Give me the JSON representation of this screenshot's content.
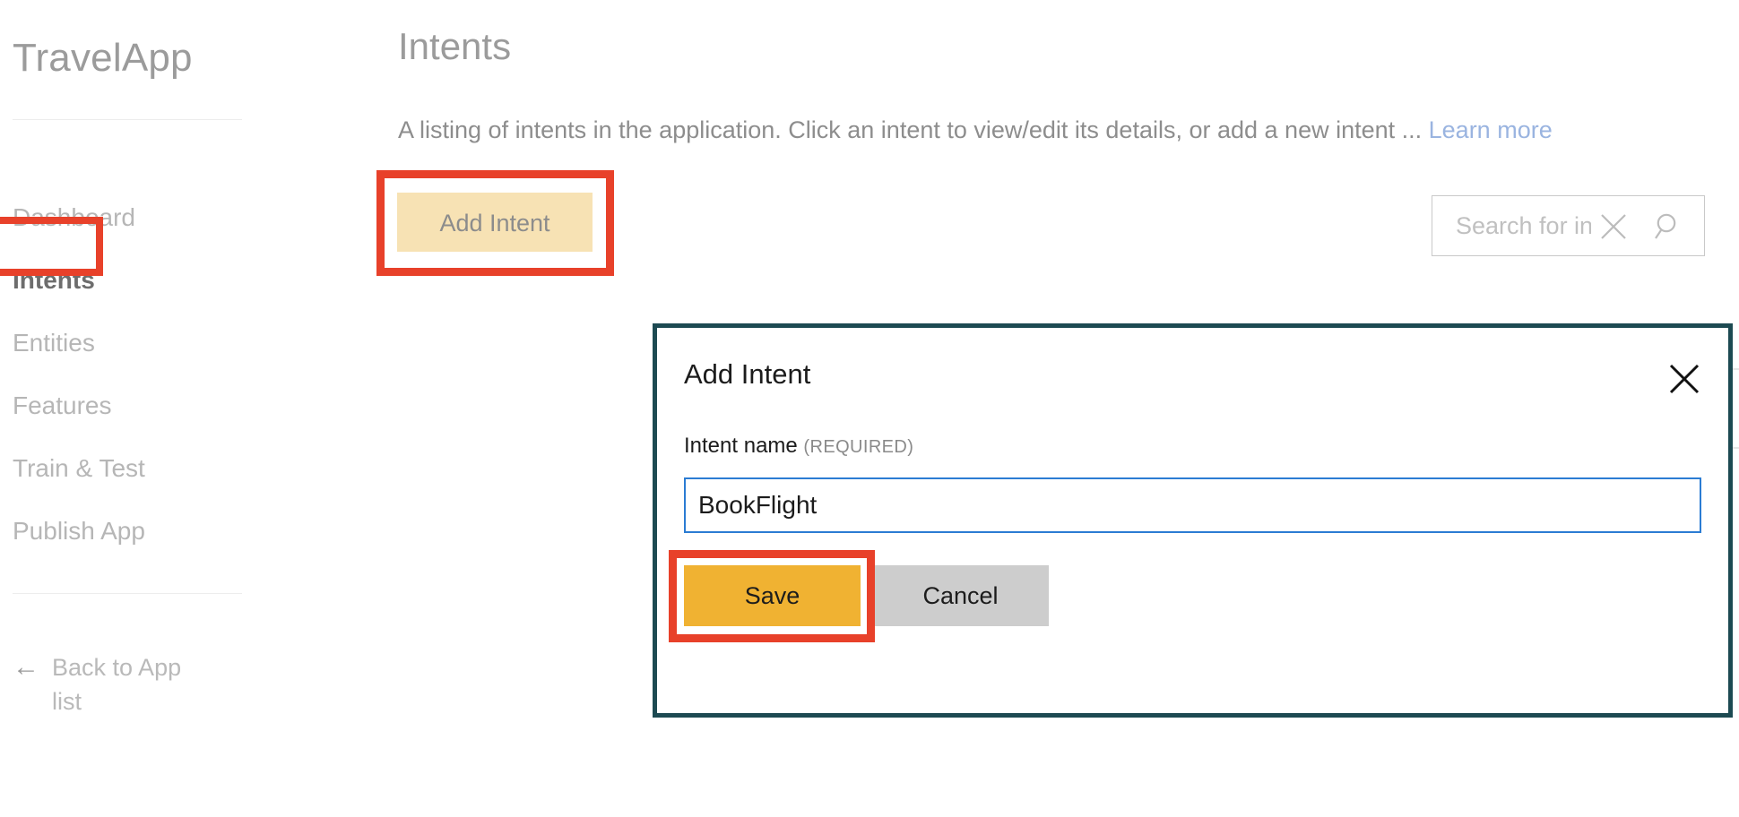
{
  "sidebar": {
    "app_title": "TravelApp",
    "items": [
      {
        "label": "Dashboard",
        "active": false
      },
      {
        "label": "Intents",
        "active": true
      },
      {
        "label": "Entities",
        "active": false
      },
      {
        "label": "Features",
        "active": false
      },
      {
        "label": "Train & Test",
        "active": false
      },
      {
        "label": "Publish App",
        "active": false
      }
    ],
    "back_link": {
      "arrow_icon": "arrow-left-icon",
      "label": "Back to App list"
    }
  },
  "main": {
    "page_title": "Intents",
    "description": "A listing of intents in the application. Click an intent to view/edit its details, or add a new intent ... ",
    "learn_more_label": "Learn more",
    "add_intent_label": "Add Intent",
    "search": {
      "value": "",
      "placeholder": "Search for intents",
      "clear_icon": "close-icon",
      "submit_icon": "search-icon"
    }
  },
  "modal": {
    "title": "Add Intent",
    "close_icon": "close-icon",
    "field_label": "Intent name",
    "field_required_tag": "(REQUIRED)",
    "intent_name_value": "BookFlight",
    "intent_name_placeholder": "",
    "save_label": "Save",
    "cancel_label": "Cancel"
  },
  "annotations": {
    "color": "#e8412a",
    "targets": [
      "sidebar-item-intents",
      "add-intent-button",
      "save-button"
    ]
  },
  "colors": {
    "annotation_red": "#e8412a",
    "add_intent_tan": "#f7e2b4",
    "save_amber": "#f0b232",
    "cancel_gray": "#cdcdcd",
    "modal_border_teal": "#1d4a52",
    "input_focus_blue": "#2b7cd3",
    "learn_more_blue": "#9ab4e0"
  }
}
